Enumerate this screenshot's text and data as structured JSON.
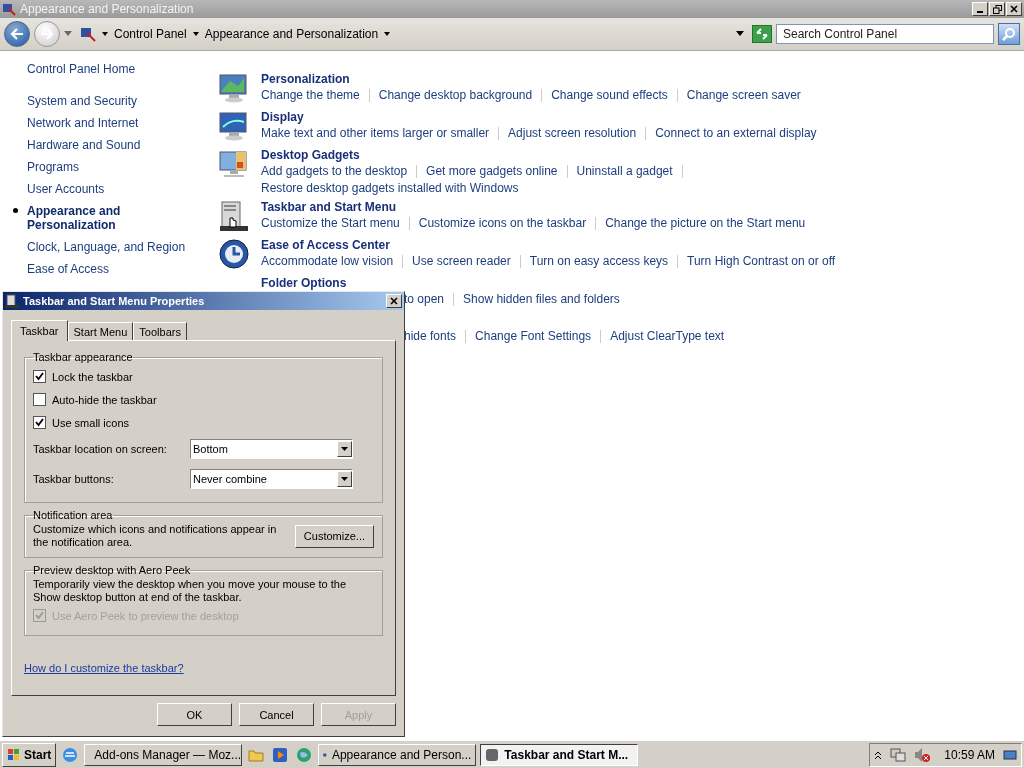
{
  "window": {
    "title": "Appearance and Personalization",
    "breadcrumbs": [
      "Control Panel",
      "Appearance and Personalization"
    ],
    "search": {
      "placeholder": "Search Control Panel"
    }
  },
  "sidebar": {
    "home": "Control Panel Home",
    "items": [
      {
        "label": "System and Security",
        "selected": false
      },
      {
        "label": "Network and Internet",
        "selected": false
      },
      {
        "label": "Hardware and Sound",
        "selected": false
      },
      {
        "label": "Programs",
        "selected": false
      },
      {
        "label": "User Accounts",
        "selected": false
      },
      {
        "label": "Appearance and Personalization",
        "selected": true
      },
      {
        "label": "Clock, Language, and Region",
        "selected": false
      },
      {
        "label": "Ease of Access",
        "selected": false
      }
    ]
  },
  "categories": [
    {
      "title": "Personalization",
      "covered": false,
      "link_lines": [
        [
          "Change the theme",
          "Change desktop background",
          "Change sound effects",
          "Change screen saver"
        ]
      ]
    },
    {
      "title": "Display",
      "covered": false,
      "link_lines": [
        [
          "Make text and other items larger or smaller",
          "Adjust screen resolution",
          "Connect to an external display"
        ]
      ]
    },
    {
      "title": "Desktop Gadgets",
      "covered": false,
      "link_lines": [
        [
          "Add gadgets to the desktop",
          "Get more gadgets online",
          "Uninstall a gadget"
        ],
        [
          "Restore desktop gadgets installed with Windows"
        ]
      ]
    },
    {
      "title": "Taskbar and Start Menu",
      "covered": false,
      "link_lines": [
        [
          "Customize the Start menu",
          "Customize icons on the taskbar",
          "Change the picture on the Start menu"
        ]
      ]
    },
    {
      "title": "Ease of Access Center",
      "covered": false,
      "link_lines": [
        [
          "Accommodate low vision",
          "Use screen reader",
          "Turn on easy access keys",
          "Turn High Contrast on or off"
        ]
      ]
    },
    {
      "title": "Folder Options",
      "covered": true,
      "link_lines": [
        [
          "to open",
          "Show hidden files and folders"
        ]
      ]
    },
    {
      "covered": true,
      "link_lines": [
        [
          "hide fonts",
          "Change Font Settings",
          "Adjust ClearType text"
        ]
      ]
    }
  ],
  "dialog": {
    "title": "Taskbar and Start Menu Properties",
    "tabs": [
      {
        "label": "Taskbar",
        "selected": true
      },
      {
        "label": "Start Menu",
        "selected": false
      },
      {
        "label": "Toolbars",
        "selected": false
      }
    ],
    "appearance": {
      "heading": "Taskbar appearance",
      "options": [
        {
          "label": "Lock the taskbar",
          "checked": true
        },
        {
          "label": "Auto-hide the taskbar",
          "checked": false
        },
        {
          "label": "Use small icons",
          "checked": true
        }
      ],
      "selects": [
        {
          "label": "Taskbar location on screen:",
          "value": "Bottom"
        },
        {
          "label": "Taskbar buttons:",
          "value": "Never combine"
        }
      ]
    },
    "notification": {
      "heading": "Notification area",
      "text": "Customize which icons and notifications appear in the notification area.",
      "button": "Customize..."
    },
    "aero_peek": {
      "heading": "Preview desktop with Aero Peek",
      "text": "Temporarily view the desktop when you move your mouse to the Show desktop button at end of the taskbar.",
      "option": {
        "label": "Use Aero Peek to preview the desktop",
        "checked": true,
        "disabled": true
      }
    },
    "help_link": "How do I customize the taskbar?",
    "buttons": [
      {
        "label": "OK",
        "disabled": false
      },
      {
        "label": "Cancel",
        "disabled": false
      },
      {
        "label": "Apply",
        "disabled": true
      }
    ]
  },
  "taskbar": {
    "start": "Start",
    "items": [
      {
        "kind": "launcher"
      },
      {
        "kind": "task",
        "label": "Add-ons Manager — Moz...",
        "selected": false
      },
      {
        "kind": "launcher"
      },
      {
        "kind": "launcher"
      },
      {
        "kind": "launcher"
      },
      {
        "kind": "task",
        "label": "Appearance and Person...",
        "selected": false
      },
      {
        "kind": "task",
        "label": "Taskbar and Start M...",
        "selected": true
      }
    ],
    "clock": "10:59 AM"
  }
}
